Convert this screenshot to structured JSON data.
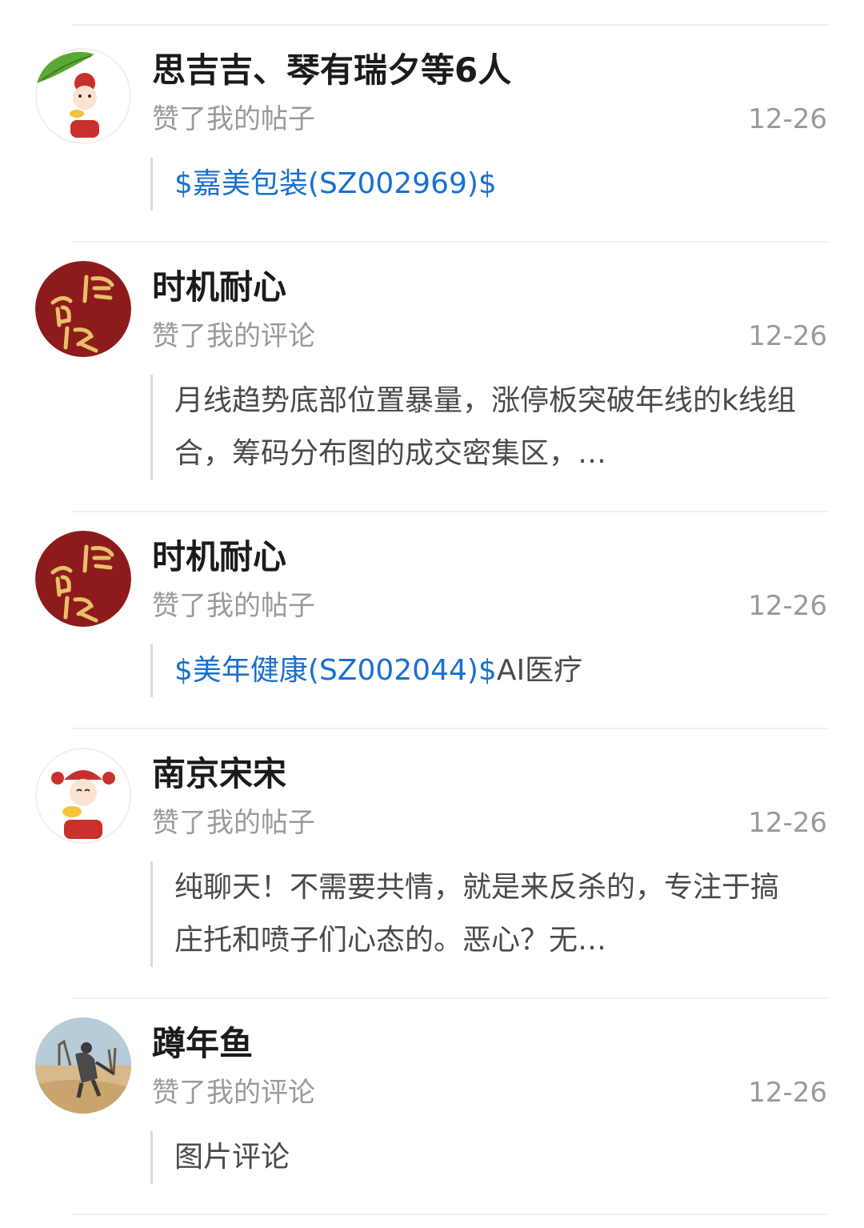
{
  "notifications": [
    {
      "name": "思吉吉、琴有瑞夕等6人",
      "action": "赞了我的帖子",
      "date": "12-26",
      "avatar_icon": "fortune-god-leaf-avatar",
      "content_link": "$嘉美包装(SZ002969)$",
      "content_text": ""
    },
    {
      "name": "时机耐心",
      "action": "赞了我的评论",
      "date": "12-26",
      "avatar_icon": "baishun-calligraphy-avatar",
      "content_link": "",
      "content_text": "月线趋势底部位置暴量，涨停板突破年线的k线组合，筹码分布图的成交密集区，…"
    },
    {
      "name": "时机耐心",
      "action": "赞了我的帖子",
      "date": "12-26",
      "avatar_icon": "baishun-calligraphy-avatar",
      "content_link": "$美年健康(SZ002044)$",
      "content_text": "AI医疗"
    },
    {
      "name": "南京宋宋",
      "action": "赞了我的帖子",
      "date": "12-26",
      "avatar_icon": "fortune-god-avatar",
      "content_link": "",
      "content_text": "纯聊天！不需要共情，就是来反杀的，专注于搞庄托和喷子们心态的。恶心？无…"
    },
    {
      "name": "蹲年鱼",
      "action": "赞了我的评论",
      "date": "12-26",
      "avatar_icon": "fisherman-photo-avatar",
      "content_link": "",
      "content_text": "图片评论"
    }
  ],
  "colors": {
    "link": "#1a6fd0",
    "secondary_text": "#9a9a9a",
    "divider": "#efefef",
    "avatar_red": "#8e1b1b"
  }
}
